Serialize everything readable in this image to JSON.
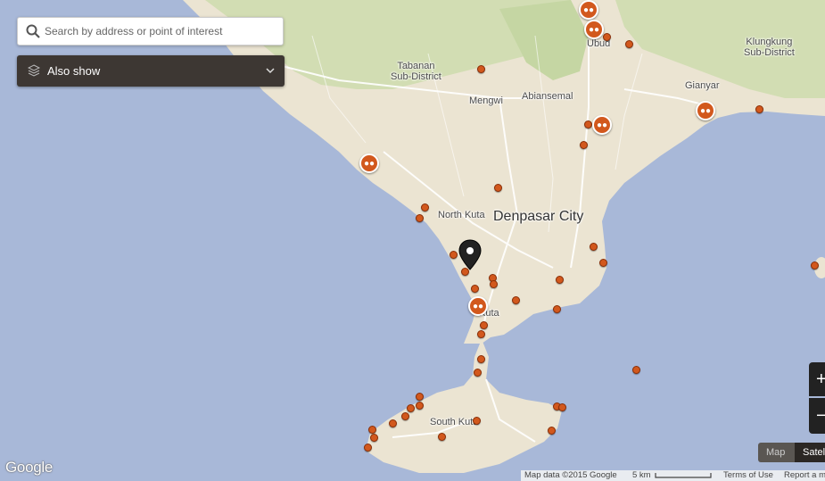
{
  "search": {
    "placeholder": "Search by address or point of interest"
  },
  "also_show": {
    "label": "Also show"
  },
  "map": {
    "labels": {
      "ubud": "Ubud",
      "klungkung": "Klungkung\nSub-District",
      "tabanan": "Tabanan\nSub-District",
      "mengwi": "Mengwi",
      "abiansemal": "Abiansemal",
      "gianyar": "Gianyar",
      "north_kuta": "North Kuta",
      "denpasar": "Denpasar City",
      "kuta": "Kuta",
      "south_kuta": "South Kuta"
    },
    "colors": {
      "water": "#a8b8d8",
      "land": "#ebe4d2",
      "green": "#cfdcb0",
      "marker": "#d2581d"
    }
  },
  "controls": {
    "zoom_in": "+",
    "zoom_out": "−",
    "map_type": {
      "map": "Map",
      "satellite": "Satellite"
    }
  },
  "footer": {
    "map_data": "Map data ©2015 Google",
    "scale": "5 km",
    "terms": "Terms of Use",
    "report": "Report a map error"
  },
  "logo": "Google"
}
